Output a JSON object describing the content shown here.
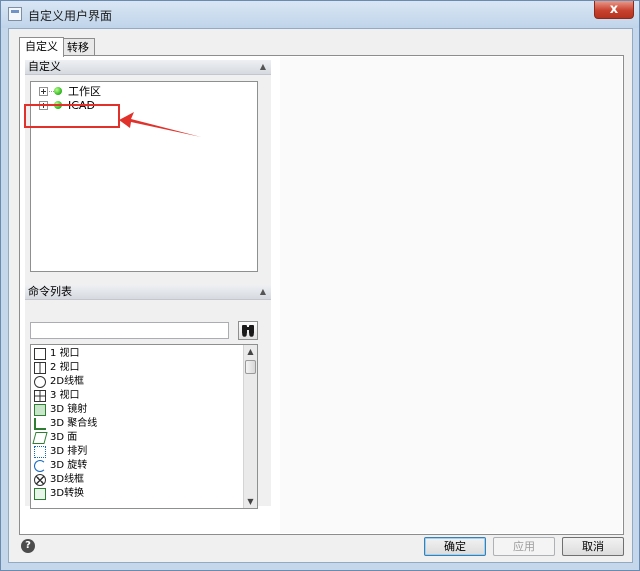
{
  "window": {
    "title": "自定义用户界面",
    "close_label": "x"
  },
  "tabs": [
    {
      "label": "自定义"
    },
    {
      "label": "转移"
    }
  ],
  "customize_section": {
    "header": "自定义",
    "tree": [
      {
        "label": "工作区"
      },
      {
        "label": "ICAD"
      }
    ]
  },
  "command_list_section": {
    "header": "命令列表",
    "search_value": "",
    "commands": [
      {
        "label": "1 视口",
        "icon": "single-viewport-icon"
      },
      {
        "label": "2 视口",
        "icon": "two-viewport-icon"
      },
      {
        "label": "2D线框",
        "icon": "2d-wireframe-icon"
      },
      {
        "label": "3 视口",
        "icon": "three-viewport-icon"
      },
      {
        "label": "3D 镜射",
        "icon": "3d-mirror-icon"
      },
      {
        "label": "3D 聚合线",
        "icon": "3d-polyline-icon"
      },
      {
        "label": "3D 面",
        "icon": "3d-face-icon"
      },
      {
        "label": "3D 排列",
        "icon": "3d-array-icon"
      },
      {
        "label": "3D 旋转",
        "icon": "3d-rotate-icon"
      },
      {
        "label": "3D线框",
        "icon": "3d-wireframe-icon"
      },
      {
        "label": "3D转换",
        "icon": "3d-convert-icon"
      }
    ]
  },
  "footer": {
    "help_label": "?",
    "ok_label": "确定",
    "apply_label": "应用",
    "cancel_label": "取消"
  },
  "annotation": {
    "highlight_color": "#e0312a"
  }
}
